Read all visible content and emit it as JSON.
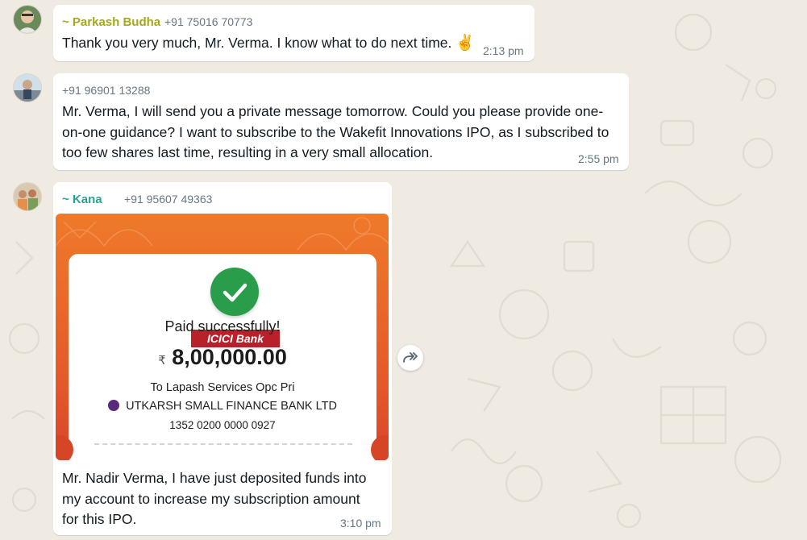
{
  "messages": [
    {
      "sender": "~ Parkash Budha",
      "phone": "+91 75016 70773",
      "text": "Thank you very much, Mr. Verma. I know what to do next time.",
      "emoji": "✌",
      "time": "2:13 pm"
    },
    {
      "phone": "+91 96901 13288",
      "lines": [
        "Mr. Verma, I will send you a private message tomorrow.  Could you please provide one-",
        "on-one guidance? I want to subscribe to the Wakefit Innovations IPO, as I subscribed to",
        "too few shares last time, resulting in a very small allocation."
      ],
      "time": "2:55 pm"
    },
    {
      "sender": "~ Kana",
      "phone": "+91 95607 49363",
      "receipt": {
        "bank": "ICICI Bank",
        "status": "Paid successfully!",
        "currency": "₹",
        "amount": "8,00,000.00",
        "payee": "To Lapash Services Opc Pri",
        "payee_bank": "UTKARSH SMALL FINANCE BANK LTD",
        "account": "1352 0200 0000 0927"
      },
      "lines": [
        "Mr. Nadir Verma, I have just deposited funds into",
        "my account to increase my subscription amount",
        "for this IPO."
      ],
      "time": "3:10 pm"
    }
  ],
  "colors": {
    "parkash_name": "#a4a816",
    "kana_name": "#1fa88f",
    "receipt_orange": "#ef7a2a",
    "success_green": "#2a9d4a",
    "icici_red": "#b9202a"
  }
}
